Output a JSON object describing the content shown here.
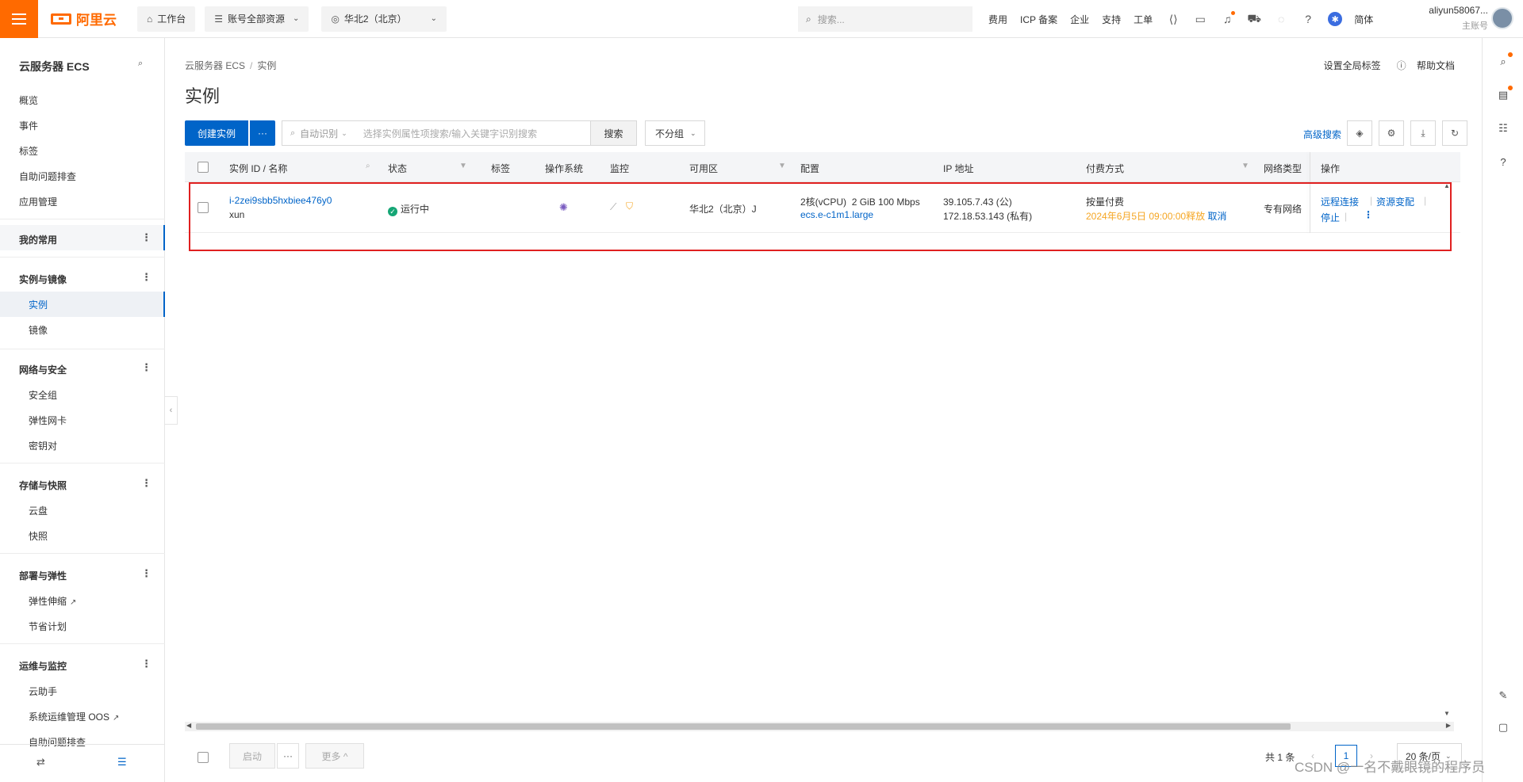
{
  "topbar": {
    "logo": "阿里云",
    "workbench": "工作台",
    "resources": "账号全部资源",
    "region": "华北2（北京）",
    "search_placeholder": "搜索...",
    "links": [
      "费用",
      "ICP 备案",
      "企业",
      "支持",
      "工单"
    ],
    "lang": "简体",
    "user_name": "aliyun58067...",
    "user_role": "主账号"
  },
  "sidebar": {
    "title": "云服务器 ECS",
    "top_items": [
      "概览",
      "事件",
      "标签",
      "自助问题排查",
      "应用管理"
    ],
    "mine": "我的常用",
    "groups": [
      {
        "label": "实例与镜像",
        "items": [
          "实例",
          "镜像"
        ]
      },
      {
        "label": "网络与安全",
        "items": [
          "安全组",
          "弹性网卡",
          "密钥对"
        ]
      },
      {
        "label": "存储与快照",
        "items": [
          "云盘",
          "快照"
        ]
      },
      {
        "label": "部署与弹性",
        "items": [
          "弹性伸缩",
          "节省计划"
        ]
      },
      {
        "label": "运维与监控",
        "items": [
          "云助手",
          "系统运维管理 OOS",
          "自助问题排查"
        ]
      }
    ]
  },
  "main": {
    "breadcrumb": [
      "云服务器 ECS",
      "实例"
    ],
    "title": "实例",
    "set_tags": "设置全局标签",
    "help": "帮助文档",
    "create_btn": "创建实例",
    "more_btn": "···",
    "auto_detect": "自动识别",
    "search_placeholder": "选择实例属性项搜索/输入关键字识别搜索",
    "search_btn": "搜索",
    "group": "不分组",
    "adv_search": "高级搜索"
  },
  "table": {
    "columns": [
      "实例 ID / 名称",
      "状态",
      "标签",
      "操作系统",
      "监控",
      "可用区",
      "配置",
      "IP 地址",
      "付费方式",
      "网络类型",
      "操作"
    ],
    "rows": [
      {
        "id": "i-2zei9sbb5hxbiee476y0",
        "name": "xun",
        "status": "运行中",
        "zone": "华北2（北京）J",
        "config_cpu": "2核(vCPU)",
        "config_mem": "2 GiB 100 Mbps",
        "config_type": "ecs.e-c1m1.large",
        "ip_public": "39.105.7.43 (公)",
        "ip_private": "172.18.53.143 (私有)",
        "billing": "按量付费",
        "release": "2024年6月5日 09:00:00释放",
        "cancel": "取消",
        "network": "专有网络",
        "op_connect": "远程连接",
        "op_change": "资源变配",
        "op_stop": "停止"
      }
    ]
  },
  "footer": {
    "start": "启动",
    "more_dots": "···",
    "more": "更多 ^",
    "total": "共 1 条",
    "page": "1",
    "page_size": "20 条/页"
  },
  "watermark": "CSDN @一名不戴眼镜的程序员"
}
